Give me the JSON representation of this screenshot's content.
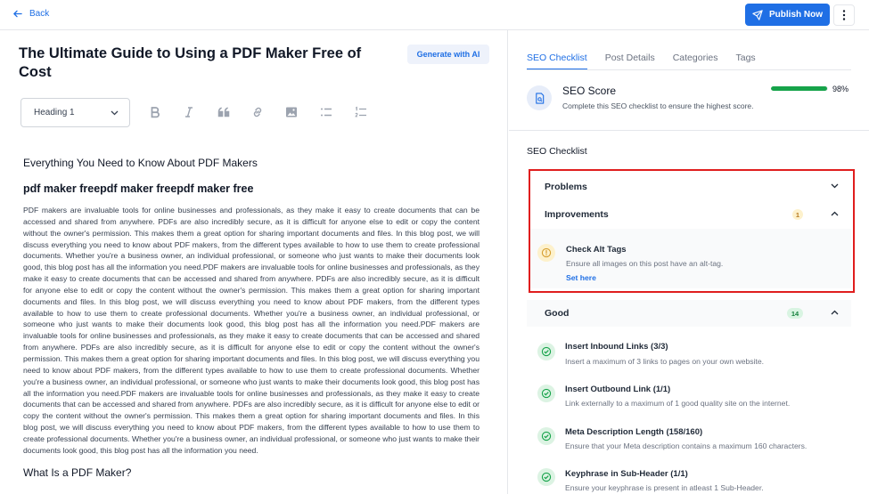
{
  "header": {
    "back_label": "Back",
    "publish_label": "Publish Now"
  },
  "editor": {
    "title": "The Ultimate Guide to Using a PDF Maker Free of Cost",
    "generate_label": "Generate with AI",
    "heading_select": "Heading 1",
    "heading_everything": "Everything You Need to Know About PDF Makers",
    "heading_keyword": "pdf maker freepdf maker freepdf maker free",
    "paragraph": "PDF makers are invaluable tools for online businesses and professionals, as they make it easy to create documents that can be accessed and shared from anywhere. PDFs are also incredibly secure, as it is difficult for anyone else to edit or copy the content without the owner's permission. This makes them a great option for sharing important documents and files. In this blog post, we will discuss everything you need to know about PDF makers, from the different types available to how to use them to create professional documents. Whether you're a business owner, an individual professional, or someone who just wants to make their documents look good, this blog post has all the information you need.PDF makers are invaluable tools for online businesses and professionals, as they make it easy to create documents that can be accessed and shared from anywhere. PDFs are also incredibly secure, as it is difficult for anyone else to edit or copy the content without the owner's permission. This makes them a great option for sharing important documents and files. In this blog post, we will discuss everything you need to know about PDF makers, from the different types available to how to use them to create professional documents. Whether you're a business owner, an individual professional, or someone who just wants to make their documents look good, this blog post has all the information you need.PDF makers are invaluable tools for online businesses and professionals, as they make it easy to create documents that can be accessed and shared from anywhere. PDFs are also incredibly secure, as it is difficult for anyone else to edit or copy the content without the owner's permission. This makes them a great option for sharing important documents and files. In this blog post, we will discuss everything you need to know about PDF makers, from the different types available to how to use them to create professional documents. Whether you're a business owner, an individual professional, or someone who just wants to make their documents look good, this blog post has all the information you need.PDF makers are invaluable tools for online businesses and professionals, as they make it easy to create documents that can be accessed and shared from anywhere. PDFs are also incredibly secure, as it is difficult for anyone else to edit or copy the content without the owner's permission. This makes them a great option for sharing important documents and files. In this blog post, we will discuss everything you need to know about PDF makers, from the different types available to how to use them to create professional documents. Whether you're a business owner, an individual professional, or someone who just wants to make their documents look good, this blog post has all the information you need.",
    "heading_what": "What Is a PDF Maker?"
  },
  "panel": {
    "tabs": [
      {
        "label": "SEO Checklist"
      },
      {
        "label": "Post Details"
      },
      {
        "label": "Categories"
      },
      {
        "label": "Tags"
      }
    ],
    "score": {
      "title": "SEO Score",
      "description": "Complete this SEO checklist to ensure the highest score.",
      "percent_label": "98%",
      "value": 0.98
    },
    "checklist_title": "SEO Checklist",
    "problems_label": "Problems",
    "improvements_label": "Improvements",
    "improvements_count": "1",
    "improvement_item": {
      "title": "Check Alt Tags",
      "description": "Ensure all images on this post have an alt-tag.",
      "action": "Set here"
    },
    "good_label": "Good",
    "good_count": "14",
    "good_items": [
      {
        "title": "Insert Inbound Links (3/3)",
        "description": "Insert a maximum of 3 links to pages on your own website."
      },
      {
        "title": "Insert Outbound Link (1/1)",
        "description": "Link externally to a maximum of 1 good quality site on the internet."
      },
      {
        "title": "Meta Description Length (158/160)",
        "description": "Ensure that your Meta description contains a maximum 160 characters."
      },
      {
        "title": "Keyphrase in Sub-Header (1/1)",
        "description": "Ensure your keyphrase is present in atleast 1 Sub-Header."
      }
    ]
  },
  "colors": {
    "accent": "#1f6fe5",
    "highlight_border": "#e01e1e",
    "success": "#16a34a",
    "warning": "#b7791f"
  }
}
